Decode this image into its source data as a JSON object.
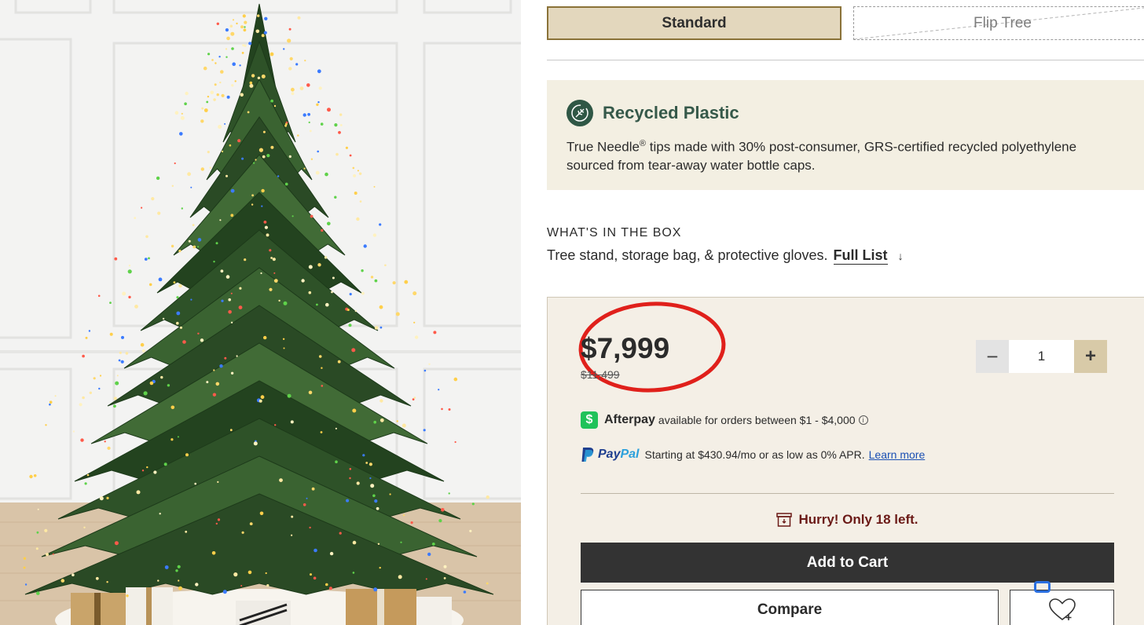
{
  "product_image": {
    "alt_icon": "christmas-tree-image"
  },
  "variants": {
    "standard_label": "Standard",
    "flip_label": "Flip Tree"
  },
  "recycled": {
    "title": "Recycled Plastic",
    "body_brand": "True Needle",
    "body_mark": "®",
    "body_rest": " tips made with 30% post-consumer, GRS-certified recycled polyethylene sourced from tear-away water bottle caps.",
    "icon": "leaf-recycle-icon"
  },
  "box": {
    "heading": "WHAT'S IN THE BOX",
    "desc": "Tree stand, storage bag, & protective gloves.",
    "full_list": "Full List",
    "arrow": "↓"
  },
  "buy": {
    "price": "$7,999",
    "old_price": "$11,499",
    "qty_minus": "−",
    "qty_value": "1",
    "qty_plus": "+",
    "afterpay_icon": "$",
    "afterpay_name": "Afterpay",
    "afterpay_text": "available for orders between $1 - $4,000",
    "afterpay_info": "i",
    "paypal_name_pay": "Pay",
    "paypal_name_pal": "Pal",
    "paypal_text": "Starting at $430.94/mo or as low as 0% APR.",
    "paypal_learn": "Learn more",
    "hurry": "Hurry! Only 18 left.",
    "add_to_cart": "Add to Cart",
    "compare": "Compare"
  },
  "colors": {
    "accent_dark": "#333333",
    "standard_bg": "#e3d7bd",
    "recycled_bg": "#f3efe2",
    "buybox_bg": "#f4efe6",
    "hurry_red": "#6b1a17",
    "price_circle": "#e0201b",
    "afterpay_green": "#20c25a",
    "paypal_blue": "#1f3f8f"
  }
}
